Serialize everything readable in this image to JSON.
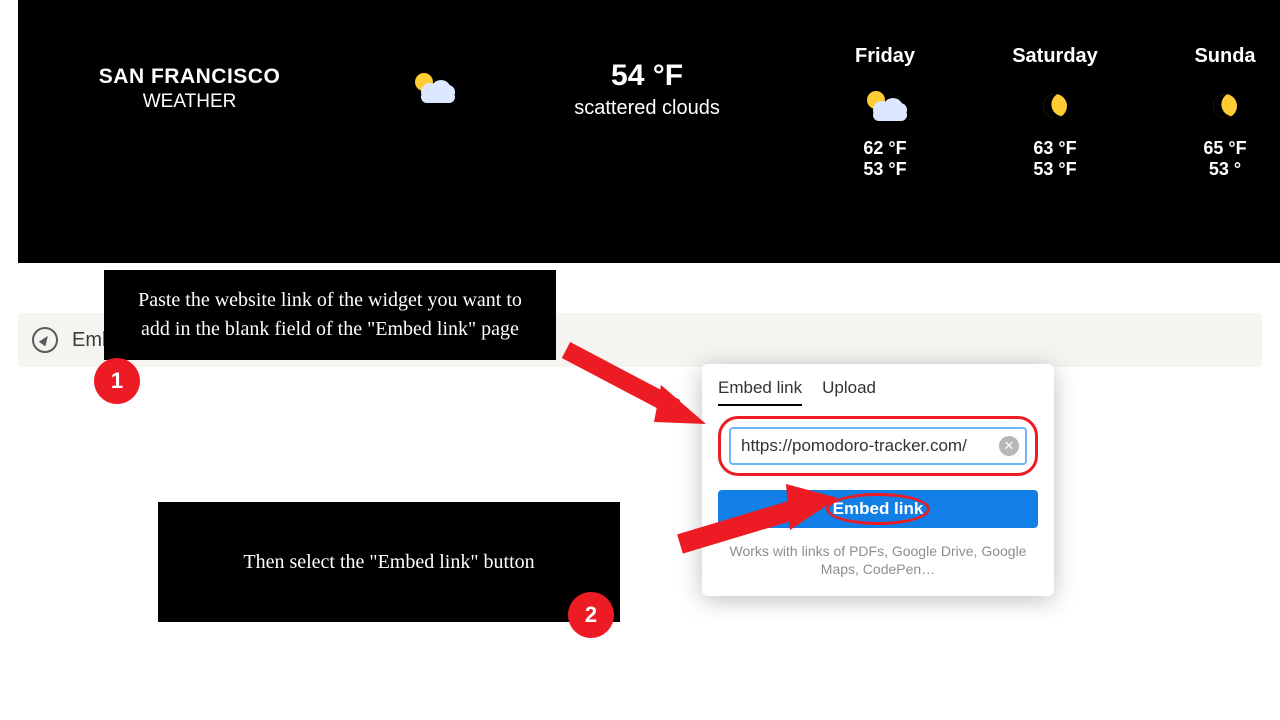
{
  "weather": {
    "city": "SAN FRANCISCO",
    "label": "WEATHER",
    "temp": "54 °F",
    "conditions": "scattered clouds",
    "forecast": [
      {
        "day": "Friday",
        "icon": "sun-cloud",
        "hi": "62 °F",
        "lo": "53 °F"
      },
      {
        "day": "Saturday",
        "icon": "moon",
        "hi": "63 °F",
        "lo": "53 °F"
      },
      {
        "day": "Sunda",
        "icon": "moon",
        "hi": "65 °F",
        "lo": "53 °"
      }
    ]
  },
  "embed_bar": {
    "label": "Emb"
  },
  "callouts": {
    "step1": "Paste the website link of the widget you want to add in the blank field of the \"Embed link\" page",
    "step2": "Then select the \"Embed link\" button",
    "badge1": "1",
    "badge2": "2"
  },
  "popup": {
    "tab_embed": "Embed link",
    "tab_upload": "Upload",
    "url_value": "https://pomodoro-tracker.com/",
    "button": "Embed link",
    "help": "Works with links of PDFs, Google Drive, Google Maps, CodePen…"
  }
}
